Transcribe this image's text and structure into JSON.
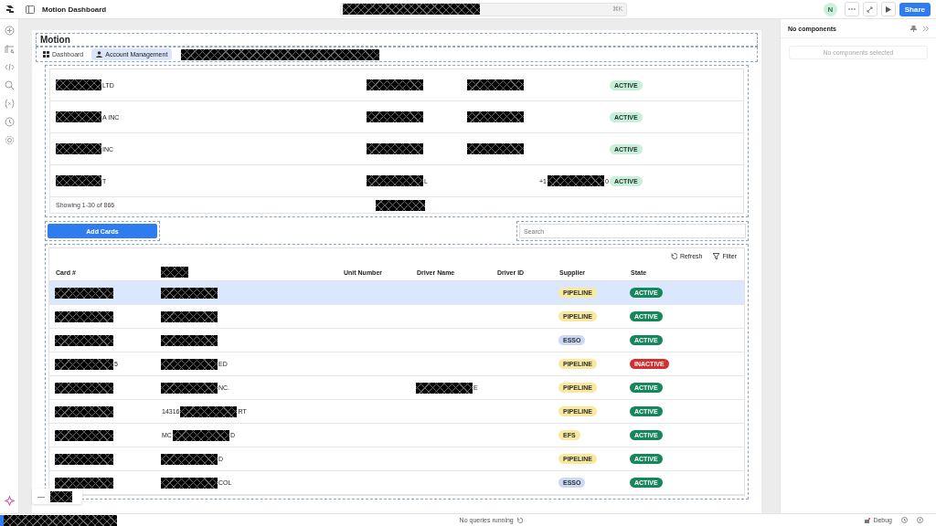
{
  "app_header": {
    "title": "Motion Dashboard",
    "search": [
      {
        "kind": "redaction"
      }
    ],
    "shortcut": "⌘K",
    "avatar": "N",
    "share": "Share"
  },
  "page": {
    "title": "Motion",
    "tabs": [
      {
        "label": "Dashboard",
        "selected": false
      },
      {
        "label": "Account Management",
        "selected": true
      }
    ],
    "tabs_extra": [
      {
        "kind": "redaction"
      }
    ]
  },
  "accounts": {
    "rows": [
      {
        "cells": [
          [
            {
              "kind": "redaction"
            },
            {
              "kind": "text",
              "text": "LTD"
            }
          ],
          [
            {
              "kind": "redaction"
            }
          ],
          [
            {
              "kind": "redaction"
            }
          ],
          []
        ],
        "status": {
          "label": "ACTIVE",
          "color": "#c6f0d9"
        }
      },
      {
        "cells": [
          [
            {
              "kind": "redaction"
            },
            {
              "kind": "text",
              "text": "A INC"
            }
          ],
          [
            {
              "kind": "redaction"
            }
          ],
          [
            {
              "kind": "redaction"
            }
          ],
          []
        ],
        "status": {
          "label": "ACTIVE",
          "color": "#c6f0d9"
        }
      },
      {
        "cells": [
          [
            {
              "kind": "redaction"
            },
            {
              "kind": "text",
              "text": "INC"
            }
          ],
          [
            {
              "kind": "redaction"
            }
          ],
          [
            {
              "kind": "redaction"
            }
          ],
          []
        ],
        "status": {
          "label": "ACTIVE",
          "color": "#c6f0d9"
        }
      },
      {
        "cells": [
          [
            {
              "kind": "redaction"
            },
            {
              "kind": "text",
              "text": "T"
            }
          ],
          [
            {
              "kind": "redaction"
            },
            {
              "kind": "text",
              "text": "L"
            }
          ],
          [],
          [
            {
              "kind": "text",
              "text": "+1"
            },
            {
              "kind": "redaction"
            },
            {
              "kind": "text",
              "text": "0"
            }
          ]
        ],
        "status": {
          "label": "ACTIVE",
          "color": "#c6f0d9"
        }
      }
    ],
    "footer": {
      "text": "Showing 1-30 of 866",
      "extra": [
        {
          "kind": "redaction"
        }
      ]
    }
  },
  "actions": {
    "add_button": "Add Cards",
    "search_placeholder": "Search"
  },
  "cards": {
    "toolbar": [
      "Refresh",
      "Filter"
    ],
    "columns": [
      [
        {
          "kind": "text",
          "text": "Card #"
        }
      ],
      [
        {
          "kind": "redaction"
        }
      ],
      [
        {
          "kind": "text",
          "text": "Unit Number"
        }
      ],
      [
        {
          "kind": "text",
          "text": "Driver Name"
        }
      ],
      [
        {
          "kind": "text",
          "text": "Driver ID"
        }
      ],
      [
        {
          "kind": "text",
          "text": "Supplier"
        }
      ],
      [
        {
          "kind": "text",
          "text": "State"
        }
      ]
    ],
    "rows": [
      {
        "selected": true,
        "cells": [
          [
            {
              "kind": "redaction"
            }
          ],
          [
            {
              "kind": "redaction"
            }
          ],
          [],
          [],
          []
        ],
        "supplier": {
          "label": "PIPELINE",
          "color": "#fbe8a0"
        },
        "state": {
          "label": "ACTIVE",
          "color": "#16875a"
        }
      },
      {
        "selected": false,
        "cells": [
          [
            {
              "kind": "redaction"
            }
          ],
          [
            {
              "kind": "redaction"
            }
          ],
          [],
          [],
          []
        ],
        "supplier": {
          "label": "PIPELINE",
          "color": "#fbe8a0"
        },
        "state": {
          "label": "ACTIVE",
          "color": "#16875a"
        }
      },
      {
        "selected": false,
        "cells": [
          [
            {
              "kind": "redaction"
            }
          ],
          [
            {
              "kind": "redaction"
            }
          ],
          [],
          [],
          []
        ],
        "supplier": {
          "label": "ESSO",
          "color": "#cdd7f6"
        },
        "state": {
          "label": "ACTIVE",
          "color": "#16875a"
        }
      },
      {
        "selected": false,
        "cells": [
          [
            {
              "kind": "redaction"
            },
            {
              "kind": "text",
              "text": "5"
            }
          ],
          [
            {
              "kind": "redaction"
            },
            {
              "kind": "text",
              "text": "ED"
            }
          ],
          [],
          [],
          []
        ],
        "supplier": {
          "label": "PIPELINE",
          "color": "#fbe8a0"
        },
        "state": {
          "label": "INACTIVE",
          "color": "#d32f2f"
        }
      },
      {
        "selected": false,
        "cells": [
          [
            {
              "kind": "redaction"
            }
          ],
          [
            {
              "kind": "redaction"
            },
            {
              "kind": "text",
              "text": "NC."
            }
          ],
          [],
          [
            {
              "kind": "redaction"
            },
            {
              "kind": "text",
              "text": "E"
            }
          ],
          []
        ],
        "supplier": {
          "label": "PIPELINE",
          "color": "#fbe8a0"
        },
        "state": {
          "label": "ACTIVE",
          "color": "#16875a"
        }
      },
      {
        "selected": false,
        "cells": [
          [
            {
              "kind": "redaction"
            }
          ],
          [
            {
              "kind": "text",
              "text": "14316"
            },
            {
              "kind": "redaction"
            },
            {
              "kind": "text",
              "text": "RT"
            }
          ],
          [],
          [],
          []
        ],
        "supplier": {
          "label": "PIPELINE",
          "color": "#fbe8a0"
        },
        "state": {
          "label": "ACTIVE",
          "color": "#16875a"
        }
      },
      {
        "selected": false,
        "cells": [
          [
            {
              "kind": "redaction"
            }
          ],
          [
            {
              "kind": "text",
              "text": "MC"
            },
            {
              "kind": "redaction"
            },
            {
              "kind": "text",
              "text": "D"
            }
          ],
          [],
          [],
          []
        ],
        "supplier": {
          "label": "EFS",
          "color": "#fbe8a0"
        },
        "state": {
          "label": "ACTIVE",
          "color": "#16875a"
        }
      },
      {
        "selected": false,
        "cells": [
          [
            {
              "kind": "redaction"
            }
          ],
          [
            {
              "kind": "redaction"
            },
            {
              "kind": "text",
              "text": "D"
            }
          ],
          [],
          [],
          []
        ],
        "supplier": {
          "label": "PIPELINE",
          "color": "#fbe8a0"
        },
        "state": {
          "label": "ACTIVE",
          "color": "#16875a"
        }
      },
      {
        "selected": false,
        "cells": [
          [
            {
              "kind": "redaction"
            }
          ],
          [
            {
              "kind": "redaction"
            },
            {
              "kind": "text",
              "text": "COL"
            }
          ],
          [],
          [],
          []
        ],
        "supplier": {
          "label": "ESSO",
          "color": "#cdd7f6"
        },
        "state": {
          "label": "ACTIVE",
          "color": "#16875a"
        }
      }
    ]
  },
  "floating": {
    "symbol": "—",
    "extra": [
      {
        "kind": "redaction"
      }
    ]
  },
  "inspector": {
    "title": "No components",
    "empty": "No components selected"
  },
  "status_bar": {
    "left": [
      {
        "kind": "redaction"
      }
    ],
    "center": "No queries running",
    "debug": "Debug"
  }
}
